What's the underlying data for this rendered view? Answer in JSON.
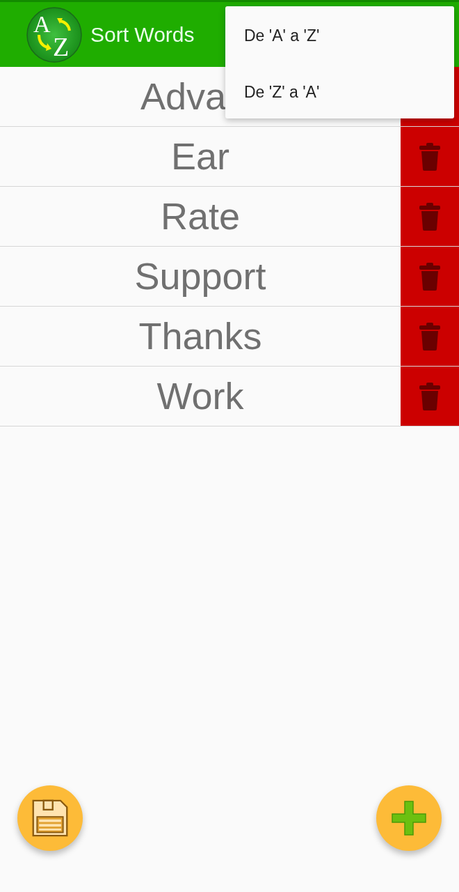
{
  "app_bar": {
    "logo_letters": [
      "A",
      "Z"
    ],
    "title": "Sort Words"
  },
  "words": [
    {
      "text": "Adva"
    },
    {
      "text": "Ear"
    },
    {
      "text": "Rate"
    },
    {
      "text": "Support"
    },
    {
      "text": "Thanks"
    },
    {
      "text": "Work"
    }
  ],
  "sort_menu": {
    "items": [
      {
        "label": "De 'A' a 'Z'"
      },
      {
        "label": "De 'Z' a 'A'"
      }
    ]
  }
}
